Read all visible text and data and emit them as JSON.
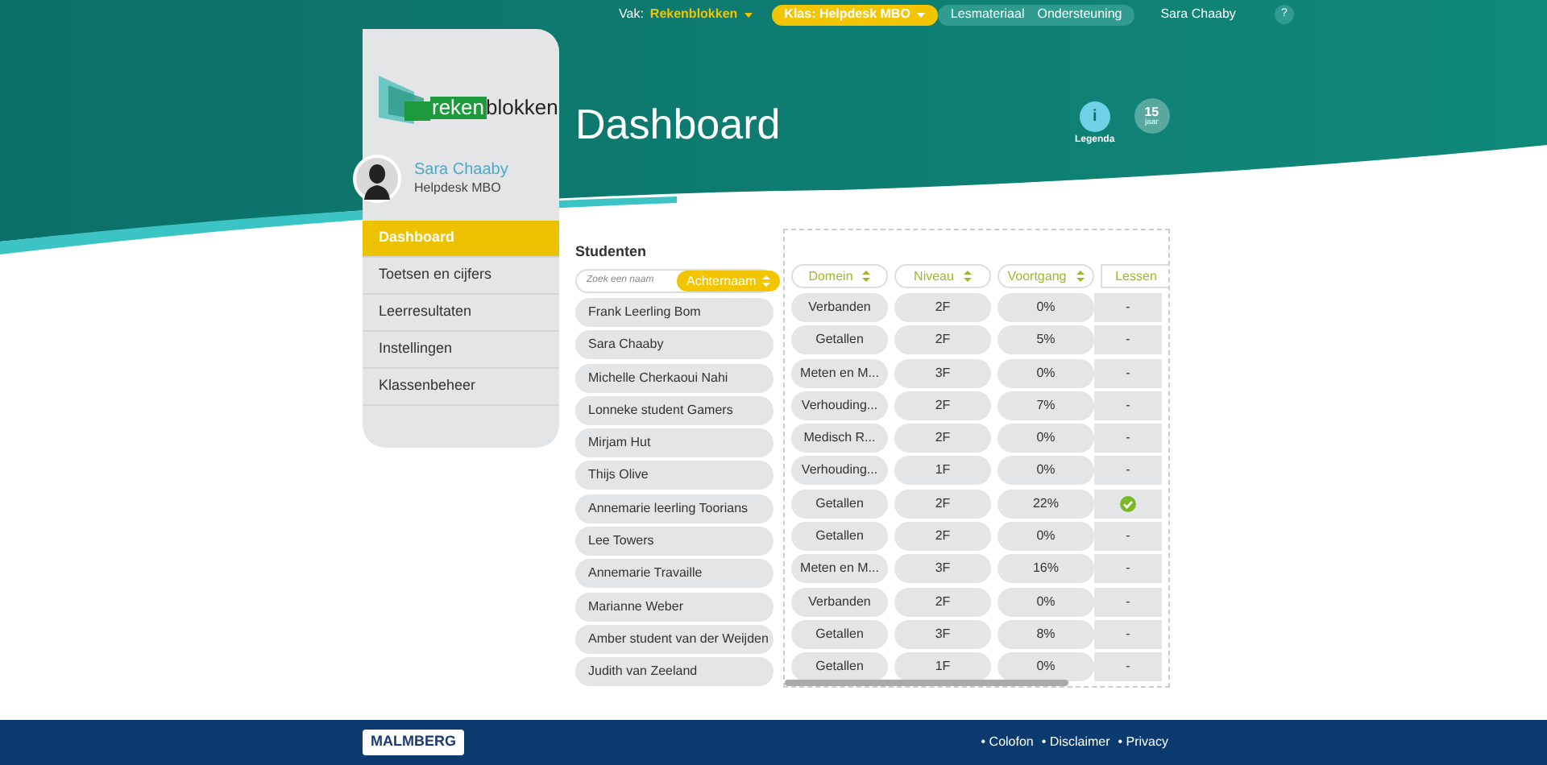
{
  "topnav": {
    "vak_label": "Vak:",
    "vak_value": "Rekenblokken",
    "class_select": "Klas: Helpdesk MBO",
    "tabs": [
      {
        "label": "Lesmateriaal",
        "selected": false
      },
      {
        "label": "Ondersteuning",
        "selected": false
      }
    ],
    "user": "Sara Chaaby",
    "help": "?"
  },
  "logo": {
    "part1": "reken",
    "part2": "blokken"
  },
  "profile": {
    "name": "Sara Chaaby",
    "group": "Helpdesk MBO"
  },
  "menu": [
    {
      "label": "Dashboard",
      "selected": true
    },
    {
      "label": "Toetsen en cijfers",
      "selected": false
    },
    {
      "label": "Leerresultaten",
      "selected": false
    },
    {
      "label": "Instellingen",
      "selected": false
    },
    {
      "label": "Klassenbeheer",
      "selected": false
    }
  ],
  "title": "Dashboard",
  "legend": {
    "label": "Legenda",
    "icon": "i"
  },
  "anniversary": {
    "number": "15",
    "unit": "jaar"
  },
  "students": {
    "heading": "Studenten",
    "search": {
      "placeholder": "Zoek een naam"
    },
    "sort": "Achternaam"
  },
  "columns": [
    {
      "label": "Domein",
      "sortable": true
    },
    {
      "label": "Niveau",
      "sortable": true
    },
    {
      "label": "Voortgang",
      "sortable": true
    },
    {
      "label": "Lessen",
      "sortable": false
    }
  ],
  "rows": [
    {
      "name": "Frank Leerling Bom",
      "domein": "Verbanden",
      "niveau": "2F",
      "voortgang": "0%",
      "lessen": "-",
      "done": false
    },
    {
      "name": "Sara Chaaby",
      "domein": "Getallen",
      "niveau": "2F",
      "voortgang": "5%",
      "lessen": "-",
      "done": false
    },
    {
      "name": "Michelle Cherkaoui Nahi",
      "domein": "Meten en M...",
      "niveau": "3F",
      "voortgang": "0%",
      "lessen": "-",
      "done": false
    },
    {
      "name": "Lonneke student Gamers",
      "domein": "Verhouding...",
      "niveau": "2F",
      "voortgang": "7%",
      "lessen": "-",
      "done": false
    },
    {
      "name": "Mirjam Hut",
      "domein": "Medisch R...",
      "niveau": "2F",
      "voortgang": "0%",
      "lessen": "-",
      "done": false
    },
    {
      "name": "Thijs Olive",
      "domein": "Verhouding...",
      "niveau": "1F",
      "voortgang": "0%",
      "lessen": "-",
      "done": false
    },
    {
      "name": "Annemarie leerling Toorians",
      "domein": "Getallen",
      "niveau": "2F",
      "voortgang": "22%",
      "done": true
    },
    {
      "name": "Lee Towers",
      "domein": "Getallen",
      "niveau": "2F",
      "voortgang": "0%",
      "lessen": "-",
      "done": false
    },
    {
      "name": "Annemarie Travaille",
      "domein": "Meten en M...",
      "niveau": "3F",
      "voortgang": "16%",
      "lessen": "-",
      "done": false
    },
    {
      "name": "Marianne Weber",
      "domein": "Verbanden",
      "niveau": "2F",
      "voortgang": "0%",
      "lessen": "-",
      "done": false
    },
    {
      "name": "Amber student van der Weijden",
      "domein": "Getallen",
      "niveau": "3F",
      "voortgang": "8%",
      "lessen": "-",
      "done": false
    },
    {
      "name": "Judith van Zeeland",
      "domein": "Getallen",
      "niveau": "1F",
      "voortgang": "0%",
      "lessen": "-",
      "done": false
    }
  ],
  "footer": {
    "logo": "MALMBERG",
    "links": [
      "• Colofon",
      "• Disclaimer",
      "• Privacy"
    ]
  }
}
